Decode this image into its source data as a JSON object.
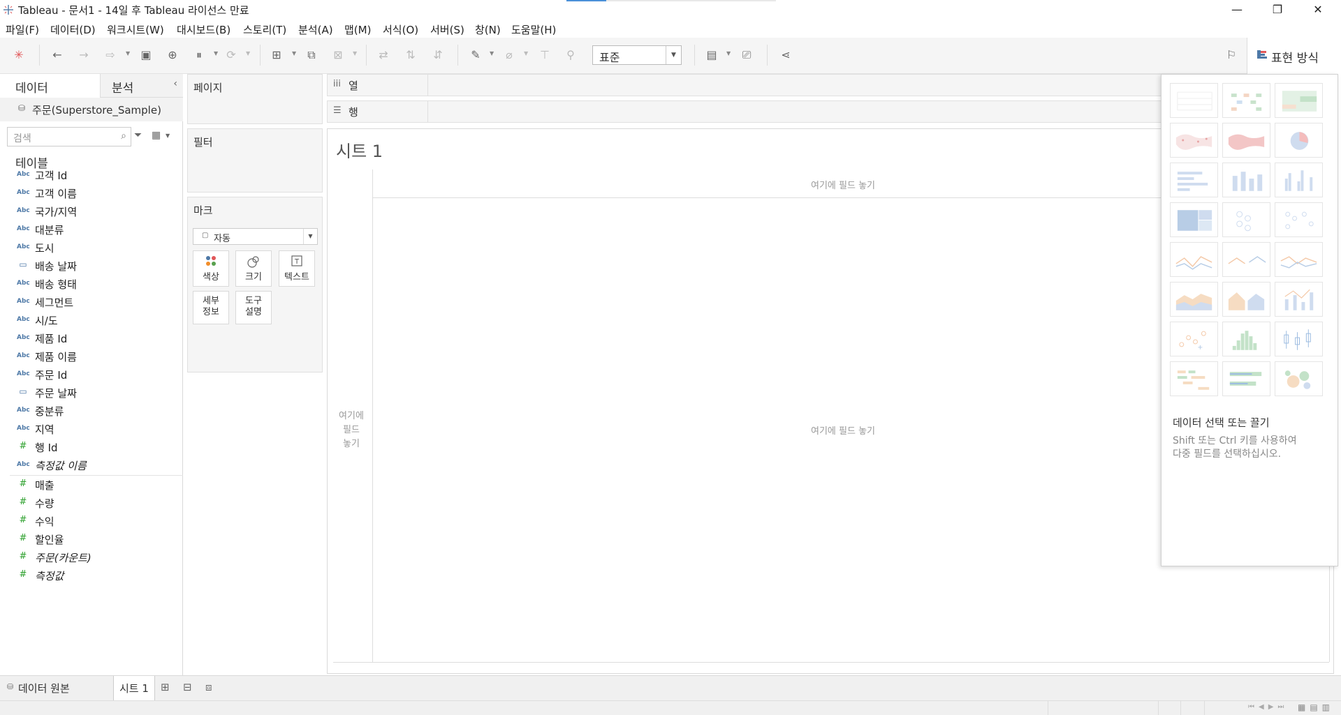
{
  "window": {
    "title": "Tableau - 문서1 - 14일 후 Tableau 라이선스 만료",
    "minimize": "—",
    "restore": "❐",
    "close": "✕"
  },
  "menu": [
    "파일(F)",
    "데이터(D)",
    "워크시트(W)",
    "대시보드(B)",
    "스토리(T)",
    "분석(A)",
    "맵(M)",
    "서식(O)",
    "서버(S)",
    "창(N)",
    "도움말(H)"
  ],
  "toolbar": {
    "fit_value": "표준",
    "show_me_label": "표현 방식"
  },
  "data_pane": {
    "tab_data": "데이터",
    "tab_analysis": "분석",
    "datasource": "주문(Superstore_Sample)",
    "search_placeholder": "검색",
    "tables_heading": "테이블",
    "dimensions": [
      {
        "icon": "Abc",
        "name": "고객 Id"
      },
      {
        "icon": "Abc",
        "name": "고객 이름"
      },
      {
        "icon": "Abc",
        "name": "국가/지역"
      },
      {
        "icon": "Abc",
        "name": "대분류"
      },
      {
        "icon": "Abc",
        "name": "도시"
      },
      {
        "icon": "date",
        "name": "배송 날짜"
      },
      {
        "icon": "Abc",
        "name": "배송 형태"
      },
      {
        "icon": "Abc",
        "name": "세그먼트"
      },
      {
        "icon": "Abc",
        "name": "시/도"
      },
      {
        "icon": "Abc",
        "name": "제품 Id"
      },
      {
        "icon": "Abc",
        "name": "제품 이름"
      },
      {
        "icon": "Abc",
        "name": "주문 Id"
      },
      {
        "icon": "date",
        "name": "주문 날짜"
      },
      {
        "icon": "Abc",
        "name": "중분류"
      },
      {
        "icon": "Abc",
        "name": "지역"
      },
      {
        "icon": "#",
        "name": "행 Id"
      },
      {
        "icon": "Abc",
        "name": "측정값 이름",
        "italic": true
      }
    ],
    "measures": [
      {
        "icon": "#",
        "name": "매출"
      },
      {
        "icon": "#",
        "name": "수량"
      },
      {
        "icon": "#",
        "name": "수익"
      },
      {
        "icon": "#",
        "name": "할인율"
      },
      {
        "icon": "#",
        "name": "주문(카운트)",
        "italic": true
      },
      {
        "icon": "#",
        "name": "측정값",
        "italic": true
      }
    ]
  },
  "cards": {
    "pages": "페이지",
    "filters": "필터",
    "marks": "마크",
    "mark_type": "자동",
    "color": "색상",
    "size": "크기",
    "text": "텍스트",
    "detail_1": "세부",
    "detail_2": "정보",
    "tooltip_1": "도구",
    "tooltip_2": "설명"
  },
  "shelves": {
    "columns": "열",
    "rows": "행"
  },
  "canvas": {
    "sheet_title": "시트 1",
    "drop_top": "여기에 필드 놓기",
    "drop_center": "여기에 필드 놓기",
    "drop_left_1": "여기에",
    "drop_left_2": "필드",
    "drop_left_3": "놓기"
  },
  "show_me": {
    "hint_title": "데이터 선택 또는 끌기",
    "hint_line1": "Shift 또는 Ctrl 키를 사용하여",
    "hint_line2": "다중 필드를 선택하십시오."
  },
  "bottom": {
    "datasource_tab": "데이터 원본",
    "sheet_tab": "시트 1"
  }
}
